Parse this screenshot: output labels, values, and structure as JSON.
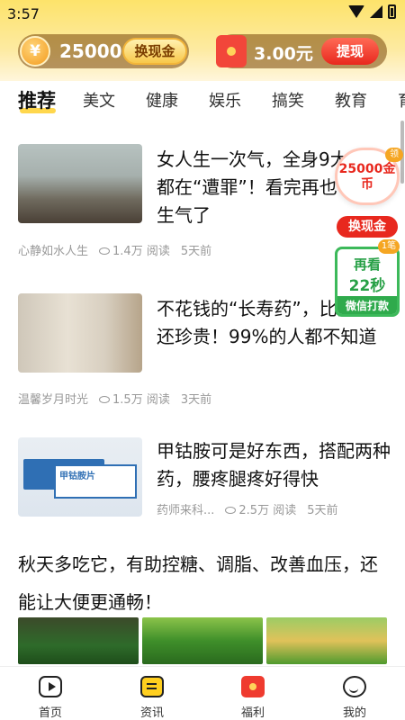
{
  "status_bar": {
    "time": "3:57"
  },
  "wallet": {
    "coins": "25000",
    "coin_symbol": "¥",
    "cash_button": "换现金",
    "money": "3.00元",
    "withdraw_button": "提现"
  },
  "tabs": [
    "推荐",
    "美文",
    "健康",
    "娱乐",
    "搞笑",
    "教育",
    "育"
  ],
  "articles": [
    {
      "title": "女人生一次气，全身9大器官都在“遭罪”！看完再也不敢生气了",
      "source": "心静如水人生",
      "reads": "1.4万 阅读",
      "time": "5天前"
    },
    {
      "title": "不花钱的“长寿药”，比金子还珍贵！99%的人都不知道",
      "source": "温馨岁月时光",
      "reads": "1.5万 阅读",
      "time": "3天前"
    },
    {
      "title": "甲钴胺可是好东西，搭配两种药，腰疼腿疼好得快",
      "source": "药师来科...",
      "reads": "2.5万 阅读",
      "time": "5天前",
      "thumb_text": "甲钴胺片"
    }
  ],
  "feature": {
    "title": "秋天多吃它，有助控糖、调脂、改善血压，还能让大便更通畅！"
  },
  "floating": {
    "coin_reward": "25000金币",
    "coin_badge": "领",
    "cash_button": "换现金",
    "watch_line1": "再看",
    "watch_line2": "22秒",
    "watch_action": "微信打款",
    "watch_badge": "1笔"
  },
  "bottom_nav": [
    {
      "label": "首页",
      "icon": "play-icon"
    },
    {
      "label": "资讯",
      "icon": "news-icon"
    },
    {
      "label": "福利",
      "icon": "gift-icon"
    },
    {
      "label": "我的",
      "icon": "smile-icon"
    }
  ]
}
